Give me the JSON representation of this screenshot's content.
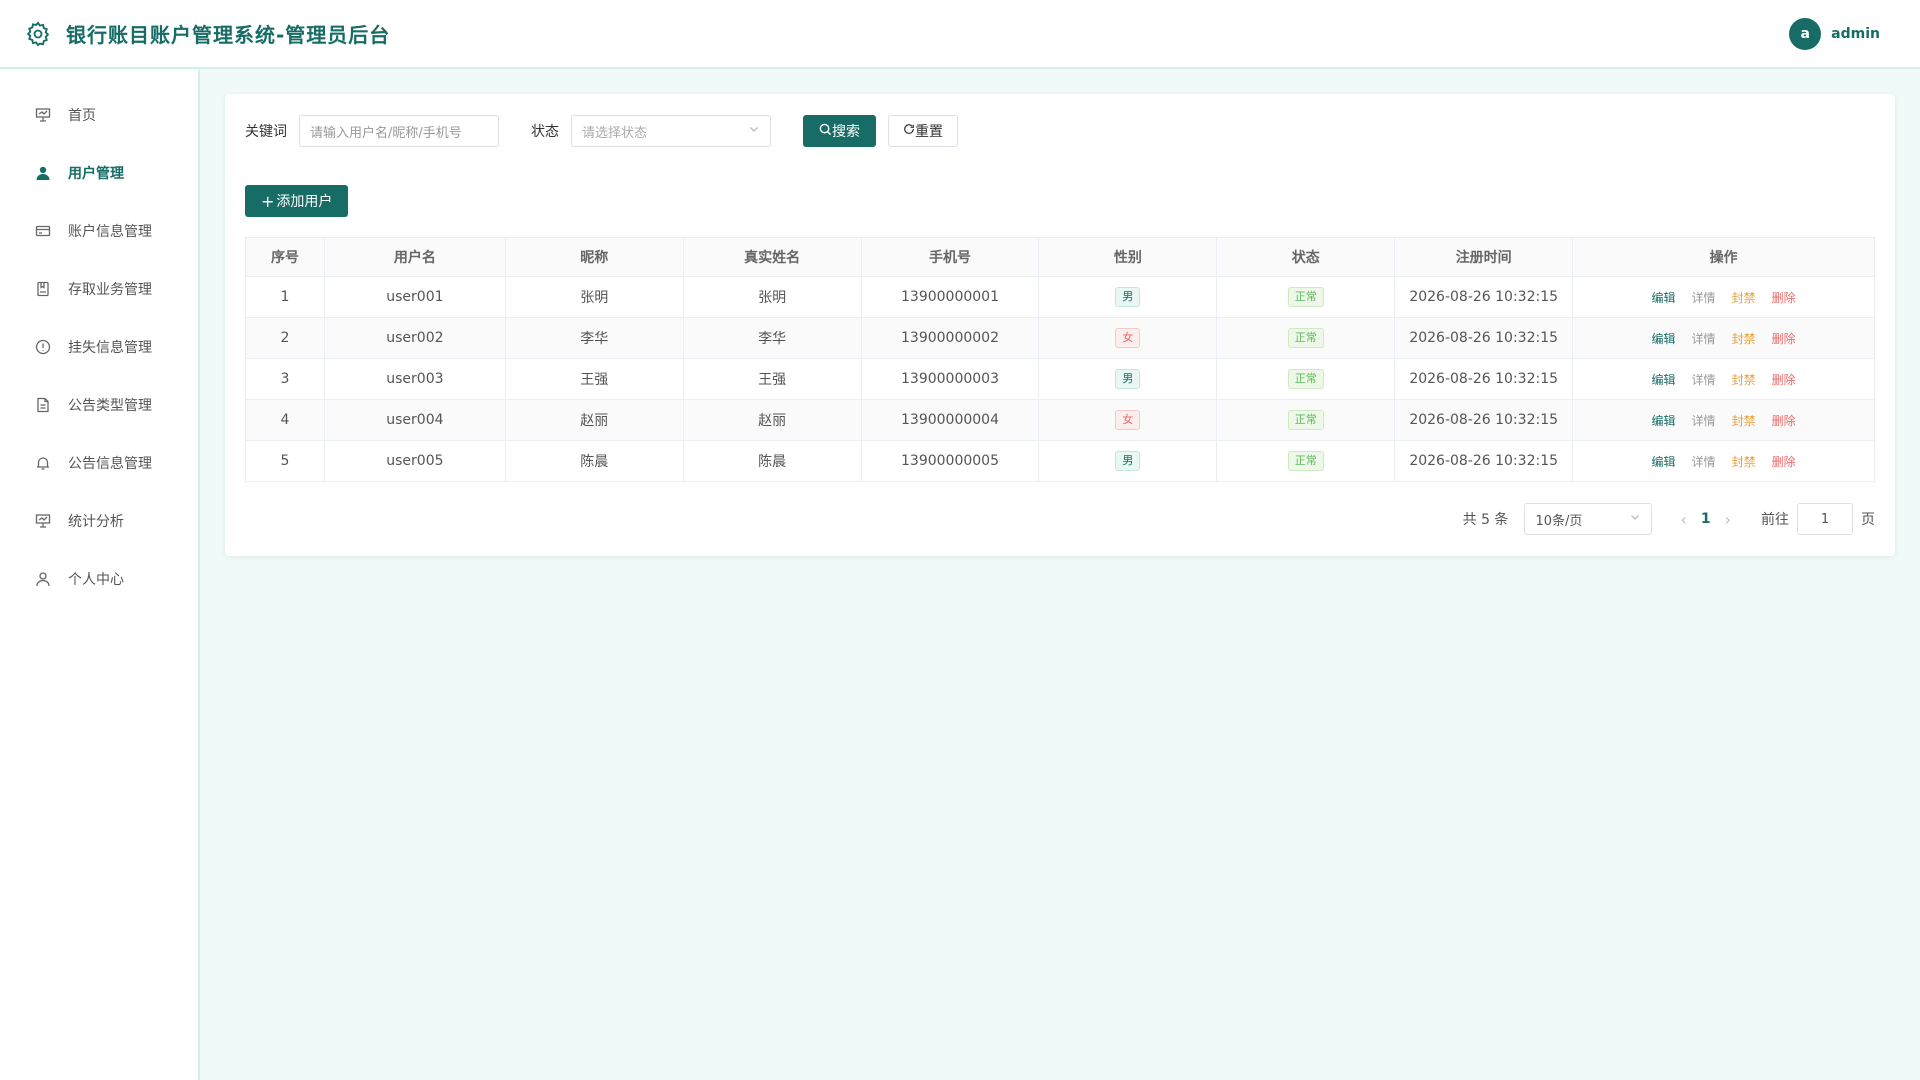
{
  "header": {
    "title": "银行账目账户管理系统-管理员后台",
    "user_initial": "a",
    "username": "admin"
  },
  "sidebar": {
    "items": [
      {
        "label": "首页",
        "icon": "presentation-icon"
      },
      {
        "label": "用户管理",
        "icon": "user-icon",
        "active": true
      },
      {
        "label": "账户信息管理",
        "icon": "credit-card-icon"
      },
      {
        "label": "存取业务管理",
        "icon": "notebook-icon"
      },
      {
        "label": "挂失信息管理",
        "icon": "warning-icon"
      },
      {
        "label": "公告类型管理",
        "icon": "document-icon"
      },
      {
        "label": "公告信息管理",
        "icon": "bell-icon"
      },
      {
        "label": "统计分析",
        "icon": "presentation-icon"
      },
      {
        "label": "个人中心",
        "icon": "person-outline-icon"
      }
    ]
  },
  "filters": {
    "keyword_label": "关键词",
    "keyword_placeholder": "请输入用户名/昵称/手机号",
    "status_label": "状态",
    "status_placeholder": "请选择状态",
    "search_label": "搜索",
    "reset_label": "重置"
  },
  "add_user_label": "添加用户",
  "table": {
    "headers": [
      "序号",
      "用户名",
      "昵称",
      "真实姓名",
      "手机号",
      "性别",
      "状态",
      "注册时间",
      "操作"
    ],
    "rows": [
      {
        "index": "1",
        "username": "user001",
        "nickname": "张明",
        "realname": "张明",
        "phone": "13900000001",
        "gender": "男",
        "status": "正常",
        "registered": "2026-08-26 10:32:15"
      },
      {
        "index": "2",
        "username": "user002",
        "nickname": "李华",
        "realname": "李华",
        "phone": "13900000002",
        "gender": "女",
        "status": "正常",
        "registered": "2026-08-26 10:32:15"
      },
      {
        "index": "3",
        "username": "user003",
        "nickname": "王强",
        "realname": "王强",
        "phone": "13900000003",
        "gender": "男",
        "status": "正常",
        "registered": "2026-08-26 10:32:15"
      },
      {
        "index": "4",
        "username": "user004",
        "nickname": "赵丽",
        "realname": "赵丽",
        "phone": "13900000004",
        "gender": "女",
        "status": "正常",
        "registered": "2026-08-26 10:32:15"
      },
      {
        "index": "5",
        "username": "user005",
        "nickname": "陈晨",
        "realname": "陈晨",
        "phone": "13900000005",
        "gender": "男",
        "status": "正常",
        "registered": "2026-08-26 10:32:15"
      }
    ],
    "ops": {
      "edit": "编辑",
      "detail": "详情",
      "ban": "封禁",
      "delete": "删除"
    }
  },
  "pager": {
    "total_text": "共 5 条",
    "page_size": "10条/页",
    "current_page": "1",
    "goto_label": "前往",
    "goto_value": "1",
    "page_suffix": "页"
  },
  "colors": {
    "brand": "#176d66",
    "female": "#e36a6a",
    "ok": "#5cb85c",
    "ban": "#e6a23c",
    "delete": "#f06a6a"
  }
}
